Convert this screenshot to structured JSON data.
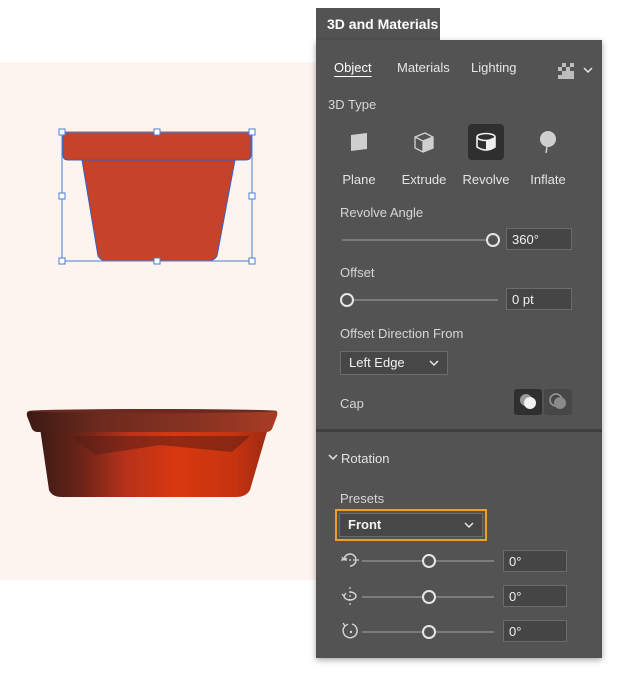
{
  "panel": {
    "title": "3D and Materials",
    "tabs": [
      {
        "label": "Object",
        "active": true
      },
      {
        "label": "Materials",
        "active": false
      },
      {
        "label": "Lighting",
        "active": false
      }
    ],
    "render_icon": "render-settings-icon",
    "menu_icon": "chevron-down-icon"
  },
  "type3d": {
    "label": "3D Type",
    "options": [
      {
        "label": "Plane",
        "icon": "plane-icon",
        "active": false
      },
      {
        "label": "Extrude",
        "icon": "extrude-icon",
        "active": false
      },
      {
        "label": "Revolve",
        "icon": "revolve-icon",
        "active": true
      },
      {
        "label": "Inflate",
        "icon": "inflate-icon",
        "active": false
      }
    ]
  },
  "revolve_angle": {
    "label": "Revolve Angle",
    "value": "360°",
    "slider_fraction": 1.0
  },
  "offset": {
    "label": "Offset",
    "value": "0 pt",
    "slider_fraction": 0.0
  },
  "offset_direction": {
    "label": "Offset Direction From",
    "value": "Left Edge"
  },
  "cap": {
    "label": "Cap",
    "options": [
      {
        "icon": "cap-on-icon",
        "active": true
      },
      {
        "icon": "cap-off-icon",
        "active": false
      }
    ]
  },
  "rotation": {
    "section_label": "Rotation",
    "presets_label": "Presets",
    "preset_value": "Front",
    "highlight_color": "#f0a020",
    "axes": [
      {
        "icon": "rotate-x-icon",
        "value": "0°",
        "slider_fraction": 0.5
      },
      {
        "icon": "rotate-y-icon",
        "value": "0°",
        "slider_fraction": 0.5
      },
      {
        "icon": "rotate-z-icon",
        "value": "0°",
        "slider_fraction": 0.5
      }
    ]
  },
  "colors": {
    "pot_fill": "#c5432a",
    "selection": "#4a7fd6",
    "panel_bg": "#535353",
    "canvas_bg": "#fdf3ef"
  }
}
